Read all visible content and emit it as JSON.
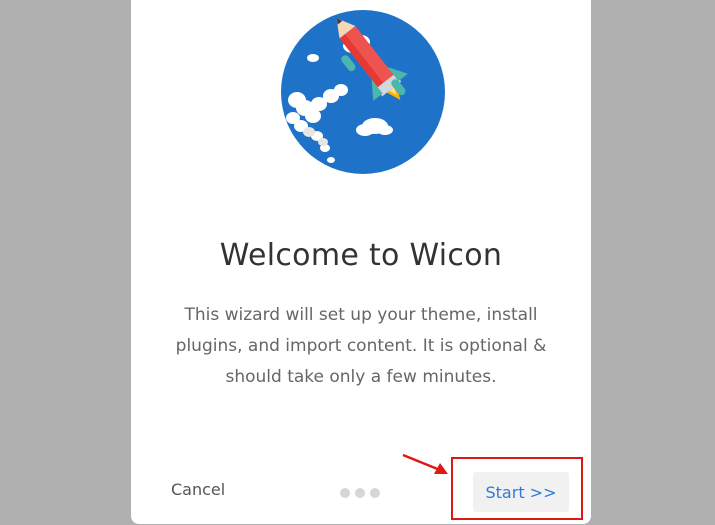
{
  "wizard": {
    "title": "Welcome to Wicon",
    "description": "This wizard will set up your theme, install plugins, and import content. It is optional & should take only a few minutes.",
    "cancel_label": "Cancel",
    "start_label": "Start >>",
    "step_indicator": {
      "total_steps": 3
    }
  },
  "illustration": {
    "icon": "rocket-pencil-illustration"
  },
  "annotation": {
    "highlight_color": "#e01717",
    "icon": "arrow-icon"
  },
  "colors": {
    "backdrop": "#b0b0b0",
    "card": "#ffffff",
    "circle_blue": "#1e73c9",
    "start_text": "#2f7ad6"
  }
}
